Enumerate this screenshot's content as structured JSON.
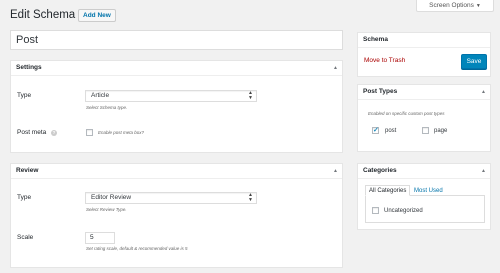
{
  "header": {
    "title": "Edit Schema",
    "add_new_label": "Add New",
    "screen_options_label": "Screen Options",
    "screen_options_caret": "▼"
  },
  "title_field": {
    "value": "Post"
  },
  "settings_panel": {
    "title": "Settings",
    "toggle": "▲",
    "type_label": "Type",
    "type_value": "Article",
    "type_hint": "Select Schema type.",
    "post_meta_label": "Post meta",
    "post_meta_help": "?",
    "post_meta_checkbox_label": "Enable post meta box?",
    "post_meta_checked": false
  },
  "review_panel": {
    "title": "Review",
    "toggle": "▲",
    "type_label": "Type",
    "type_value": "Editor Review",
    "type_hint": "Select Review Type.",
    "scale_label": "Scale",
    "scale_value": "5",
    "scale_hint": "Set rating scale, default & recommended value is 5"
  },
  "schema_box": {
    "title": "Schema",
    "trash_label": "Move to Trash",
    "save_label": "Save"
  },
  "post_types_box": {
    "title": "Post Types",
    "toggle": "▲",
    "hint": "Enabled on specific custom post types",
    "items": [
      {
        "label": "post",
        "checked": true
      },
      {
        "label": "page",
        "checked": false
      }
    ]
  },
  "categories_box": {
    "title": "Categories",
    "toggle": "▲",
    "tab_all": "All Categories",
    "tab_most_used": "Most Used",
    "items": [
      {
        "label": "Uncategorized",
        "checked": false
      }
    ]
  },
  "colors": {
    "accent": "#0073aa",
    "primary_button": "#0085ba",
    "trash": "#a00000",
    "background": "#f1f1f1"
  },
  "icons": {
    "select_arrows": "▲▼",
    "help": "question-circle-icon",
    "check": "checkmark-icon"
  }
}
